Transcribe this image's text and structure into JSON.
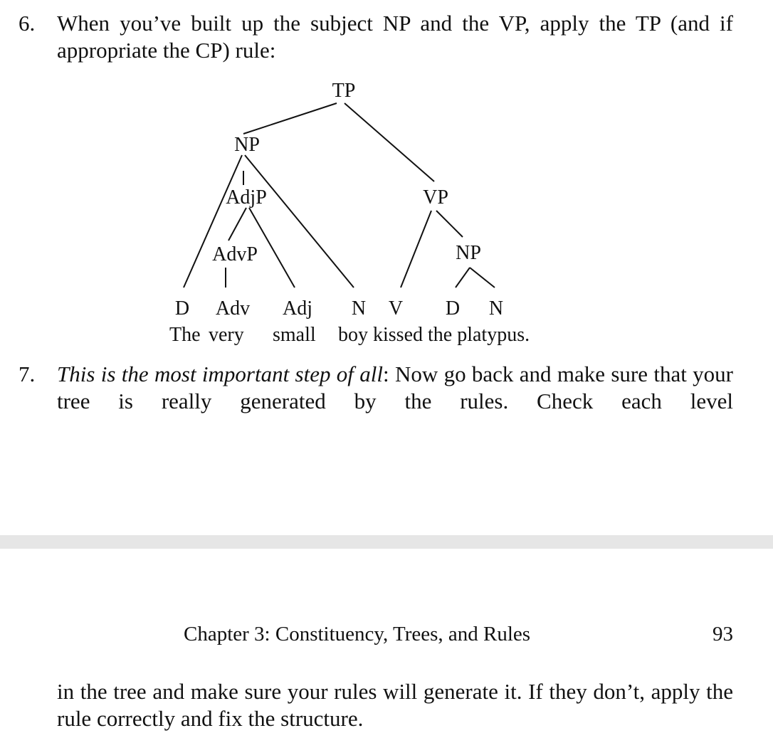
{
  "item6": {
    "number": "6.",
    "text": "When you’ve built up the subject NP and the VP, apply the TP (and if appropriate the CP) rule:"
  },
  "tree": {
    "nodes": {
      "tp": "TP",
      "np_subject": "NP",
      "adjp": "AdjP",
      "advp": "AdvP",
      "vp": "VP",
      "np_object": "NP",
      "d1": "D",
      "adv": "Adv",
      "adj": "Adj",
      "n1": "N",
      "v": "V",
      "d2": "D",
      "n2": "N"
    },
    "words": {
      "the": "The",
      "very": "very",
      "small": "small",
      "rest": "boy kissed the platypus."
    }
  },
  "item7": {
    "number": "7.",
    "emphasis": "This is the most important step of all",
    "text": ": Now go back and make sure that your tree is really generated by the rules. Check each level"
  },
  "footer": {
    "chapter_title": "Chapter 3: Constituency, Trees, and Rules",
    "page_number": "93"
  },
  "continuation": "in the tree and make sure your rules will generate it. If they don’t, apply the rule correctly and fix the structure."
}
